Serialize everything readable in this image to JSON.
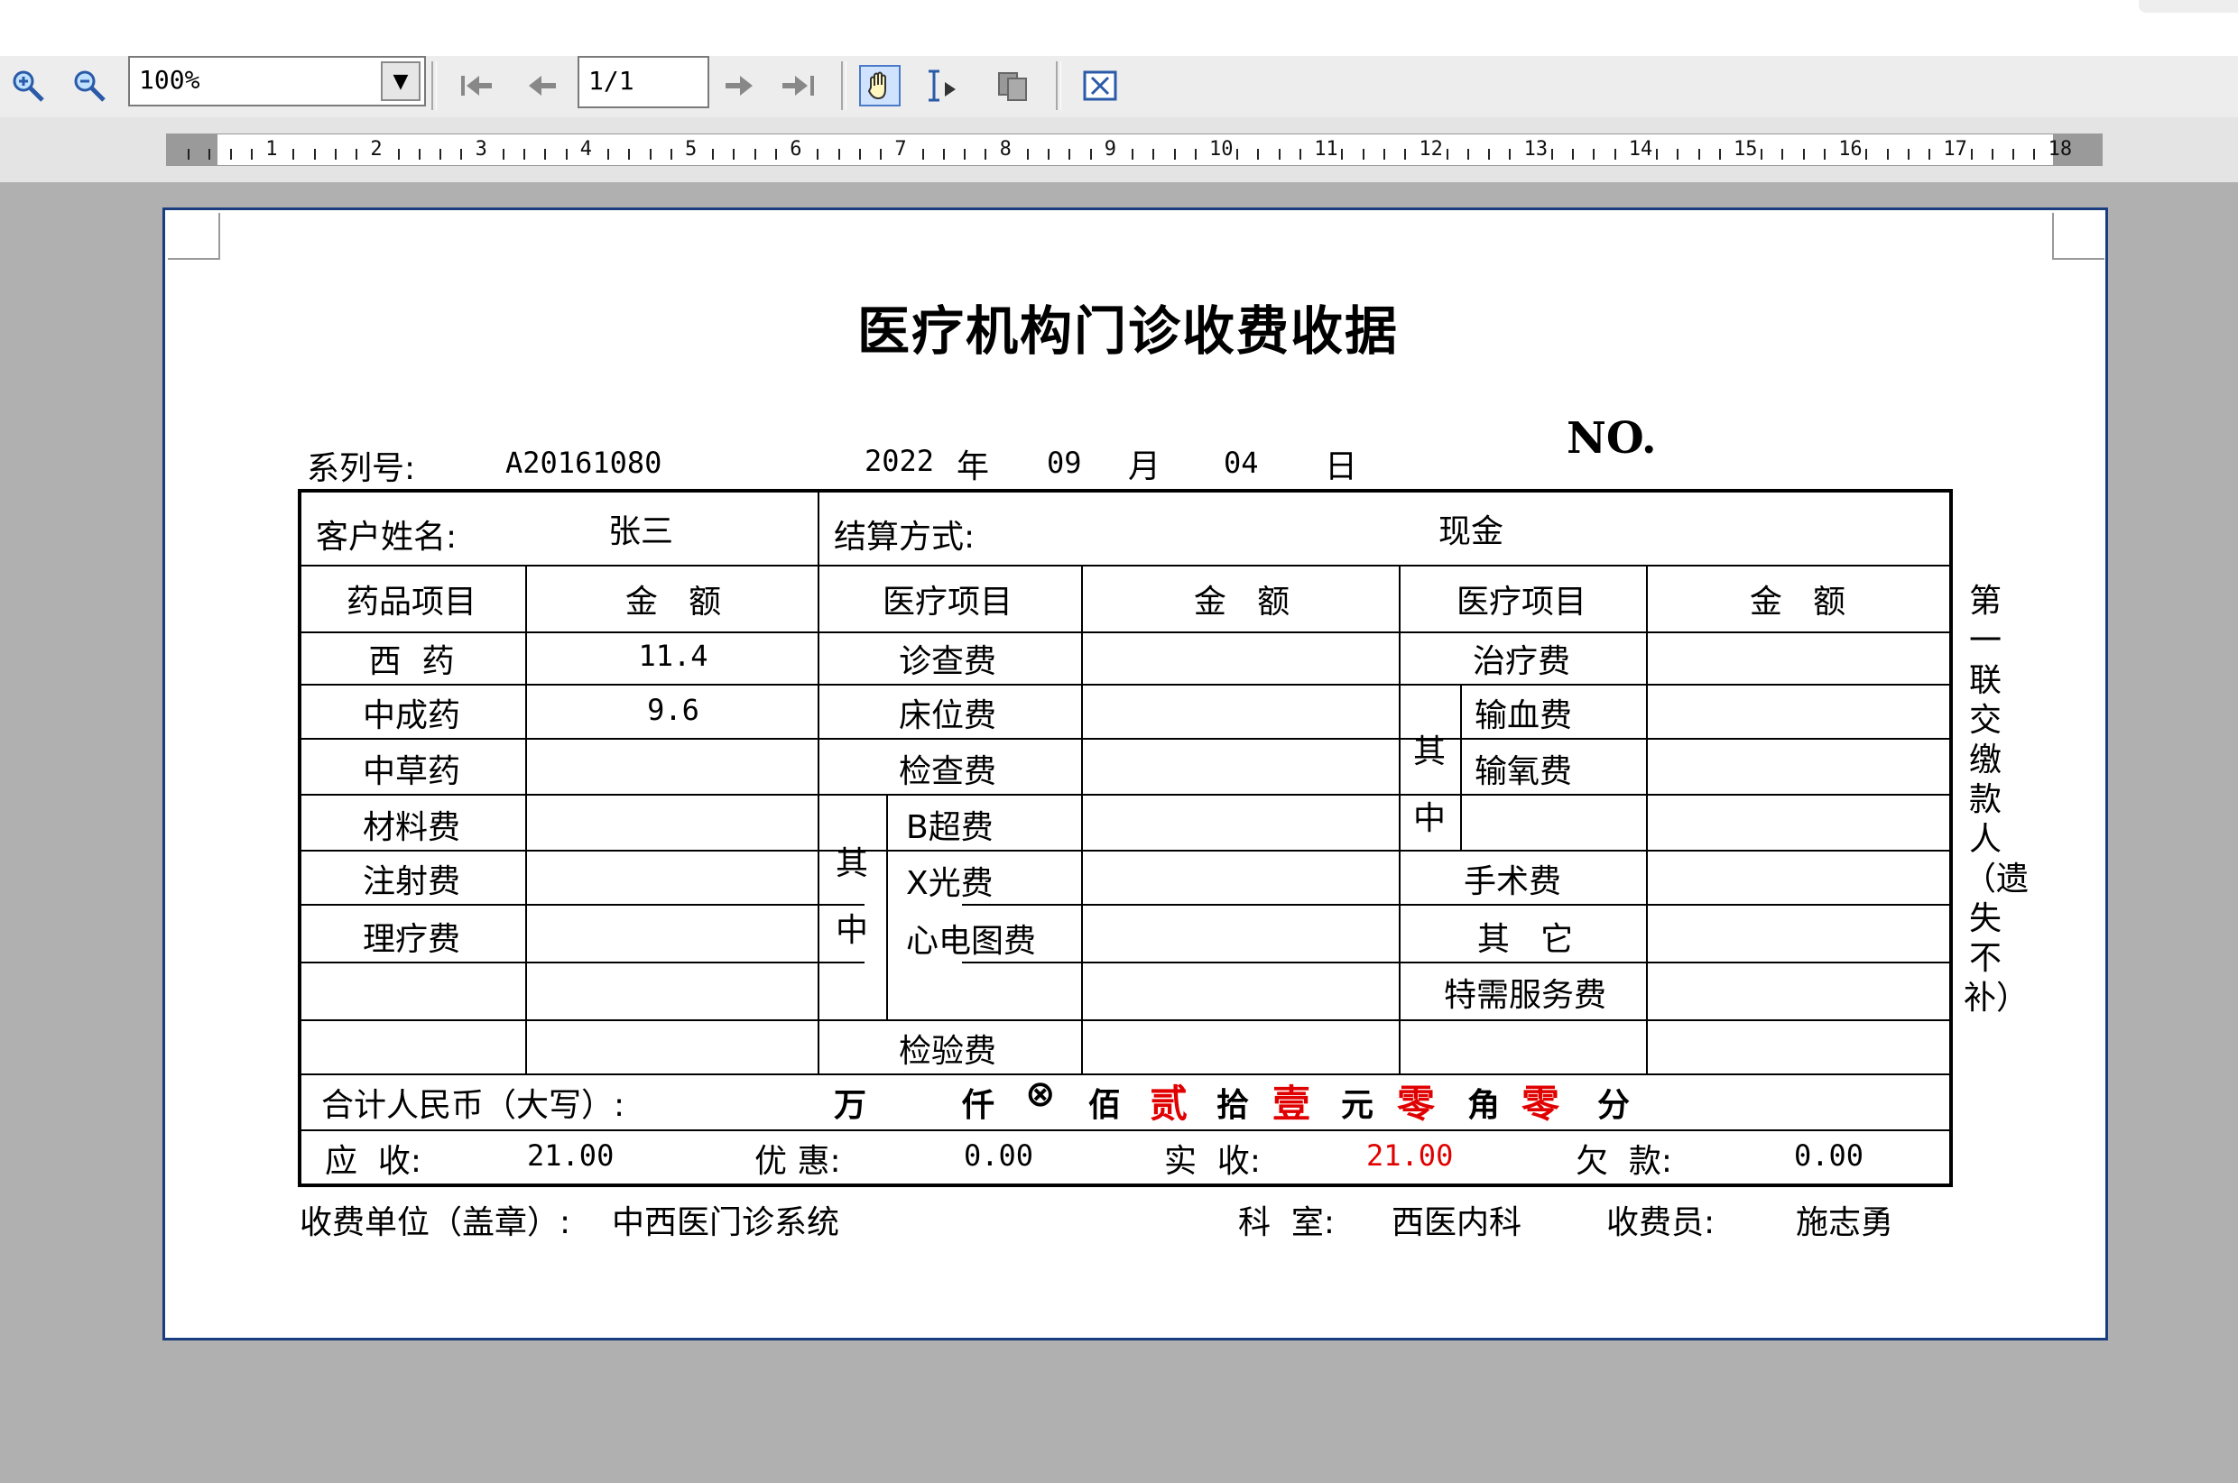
{
  "toolbar": {
    "zoom_value": "100%",
    "page_value": "1/1",
    "icons": [
      "zoom-in-icon",
      "zoom-out-icon",
      "first-page-icon",
      "prev-page-icon",
      "next-page-icon",
      "last-page-icon",
      "hand-tool-icon",
      "text-select-icon",
      "copy-icon",
      "close-icon"
    ]
  },
  "ruler": {
    "labels": [
      "1",
      "2",
      "3",
      "4",
      "5",
      "6",
      "7",
      "8",
      "9",
      "10",
      "11",
      "12",
      "13",
      "14",
      "15",
      "16",
      "17",
      "18"
    ]
  },
  "receipt": {
    "title": "医疗机构门诊收费收据",
    "serial_label": "系列号:",
    "serial_value": "A20161080",
    "year": "2022",
    "year_label": "年",
    "month": "09",
    "month_label": "月",
    "day": "04",
    "day_label": "日",
    "no_label": "NO.",
    "customer_label": "客户姓名:",
    "customer_name": "张三",
    "payment_label": "结算方式:",
    "payment_method": "现金",
    "col_drug_item": "药品项目",
    "col_amount": "金   额",
    "col_medical_item": "医疗项目",
    "drugs": [
      {
        "name": "西  药",
        "amount": "11.4"
      },
      {
        "name": "中成药",
        "amount": "9.6"
      },
      {
        "name": "中草药",
        "amount": ""
      },
      {
        "name": "材料费",
        "amount": ""
      },
      {
        "name": "注射费",
        "amount": ""
      },
      {
        "name": "理疗费",
        "amount": ""
      }
    ],
    "mid_items": {
      "exam": "诊查费",
      "bed": "床位费",
      "check": "检查费",
      "qizhong_1": "其",
      "qizhong_2": "中",
      "bultrasound": "B超费",
      "xray": "X光费",
      "ecg": "心电图费",
      "lab": "检验费"
    },
    "right_items": {
      "treatment": "治疗费",
      "qizhong_1": "其",
      "qizhong_2": "中",
      "transfusion": "输血费",
      "oxygen": "输氧费",
      "surgery": "手术费",
      "other": "其   它",
      "special": "特需服务费"
    },
    "total_label": "合计人民币（大写）:",
    "wan": "万",
    "qian": "仟",
    "crossed": "⊗",
    "bai": "佰",
    "shi_digit": "贰",
    "shi": "拾",
    "yuan_digit": "壹",
    "yuan": "元",
    "jiao_digit": "零",
    "jiao": "角",
    "fen_digit": "零",
    "fen": "分",
    "receivable_label": "应  收:",
    "receivable": "21.00",
    "discount_label": "优 惠:",
    "discount": "0.00",
    "received_label": "实  收:",
    "received": "21.00",
    "owed_label": "欠  款:",
    "owed": "0.00",
    "unit_label": "收费单位（盖章）:",
    "unit": "中西医门诊系统",
    "dept_label": "科  室:",
    "dept": "西医内科",
    "cashier_label": "收费员:",
    "cashier": "施志勇",
    "side_text": "第一联 交缴款人（遗失不补）",
    "colors": {
      "red": "#e00000",
      "border": "#1a3d80"
    }
  }
}
